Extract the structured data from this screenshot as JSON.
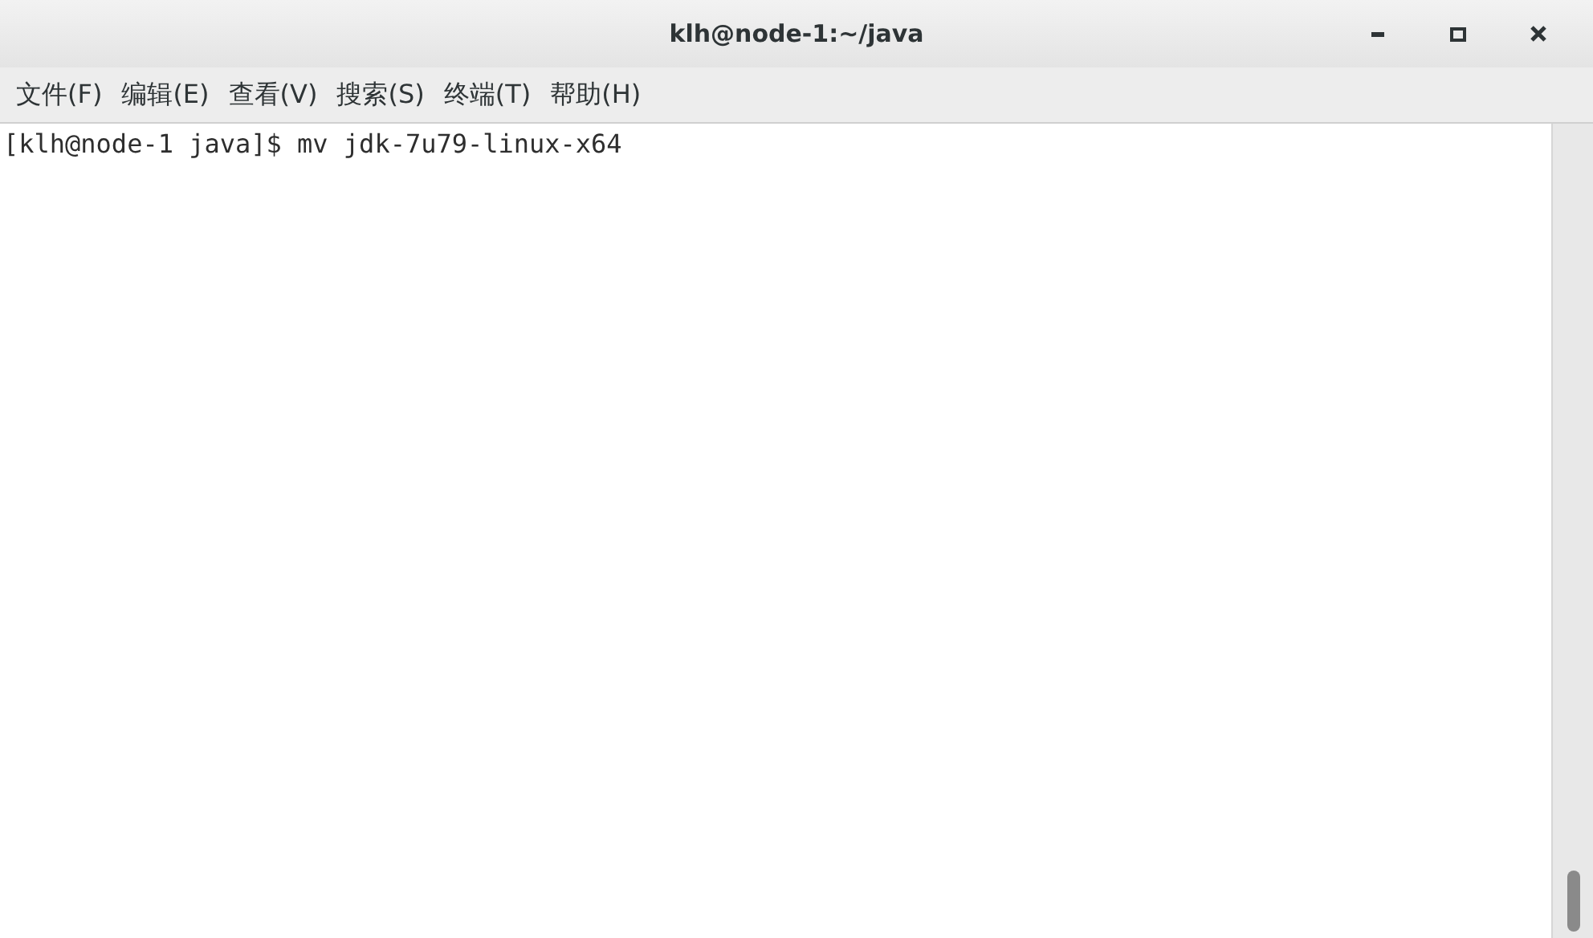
{
  "window": {
    "title": "klh@node-1:~/java"
  },
  "menu": [
    "文件(F)",
    "编辑(E)",
    "查看(V)",
    "搜索(S)",
    "终端(T)",
    "帮助(H)"
  ],
  "terminal": {
    "lines": [
      "[klh@node-1 java]$ mv jdk-7u79-linux-x64"
    ]
  }
}
